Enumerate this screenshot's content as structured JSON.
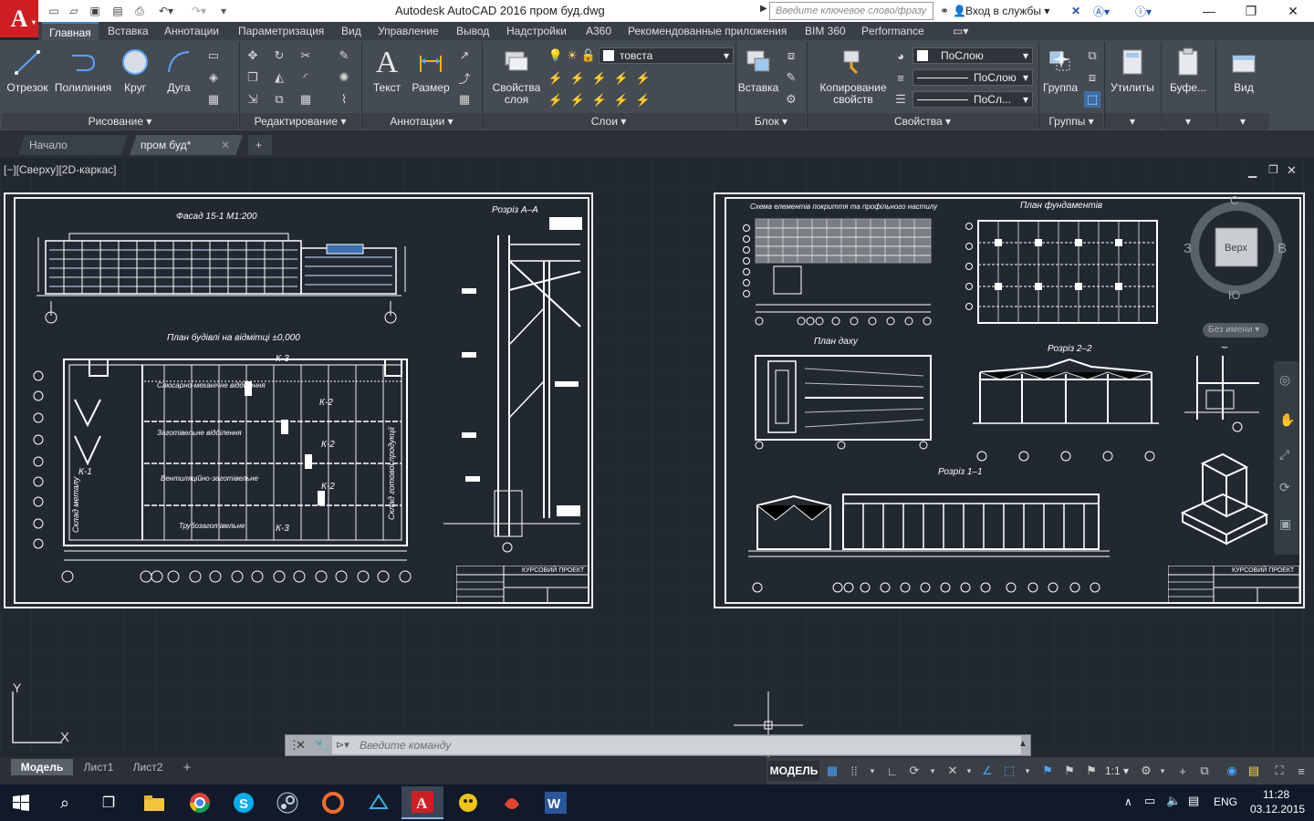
{
  "app": {
    "logo_letter": "A",
    "title": "Autodesk AutoCAD 2016    пром буд.dwg",
    "search_placeholder": "Введите ключевое слово/фразу",
    "login": "Вход в службы",
    "accent": "#3b88c8",
    "brand": "#cf1f25"
  },
  "ribbon_tabs": [
    "Главная",
    "Вставка",
    "Аннотации",
    "Параметризация",
    "Вид",
    "Управление",
    "Вывод",
    "Надстройки",
    "A360",
    "Рекомендованные приложения",
    "BIM 360",
    "Performance"
  ],
  "ribbon": {
    "draw": {
      "line": "Отрезок",
      "polyline": "Полилиния",
      "circle": "Круг",
      "arc": "Дуга",
      "panel": "Рисование"
    },
    "modify": {
      "panel": "Редактирование"
    },
    "annotation": {
      "text": "Текст",
      "dimension": "Размер",
      "panel": "Аннотации"
    },
    "layers": {
      "props": "Свойства слоя",
      "current_layer": "товста",
      "panel": "Слои"
    },
    "block": {
      "insert": "Вставка",
      "panel": "Блок"
    },
    "properties": {
      "copy": "Копирование свойств",
      "color": "ПоСлою",
      "linetype": "ПоСлою",
      "lineweight": "ПоСл...",
      "panel": "Свойства"
    },
    "groups": {
      "group": "Группа",
      "panel": "Группы"
    },
    "utilities": "Утилиты",
    "clipboard": "Буфе...",
    "view": "Вид"
  },
  "doc_tabs": {
    "start": "Начало",
    "current": "пром буд*"
  },
  "viewport": {
    "label": "[−][Сверху][2D-каркас]"
  },
  "viewcube": {
    "top": "Верх",
    "north": "С",
    "south": "Ю",
    "east": "В",
    "west": "З",
    "wcs": "Без имени"
  },
  "sheet_left": {
    "facade": "Фасад 15-1 М1:200",
    "plan": "План будівлі на відмітці ±0,000",
    "section": "Розріз А–А",
    "k3": "К-3",
    "k2": "К-2",
    "k1": "К-1",
    "room1": "Слюсарно-механічне відділення",
    "room2": "Заготівельне відділення",
    "room3": "Вентиляційно-заготівельне",
    "room4": "Трубозаготівельне",
    "store1": "Склад металу",
    "store2": "Склад готової продукції",
    "stamp": "КУРСОВИЙ ПРОЕКТ"
  },
  "sheet_right": {
    "scheme": "Схема елементів покриття та профільного настилу",
    "foundation": "План фундаментів",
    "roof": "План даху",
    "section22": "Розріз 2–2",
    "section11": "Розріз 1–1",
    "stamp": "КУРСОВИЙ ПРОЕКТ"
  },
  "axes": {
    "x": "X",
    "y": "Y"
  },
  "command": {
    "placeholder": "Введите команду"
  },
  "layout_tabs": [
    "Модель",
    "Лист1",
    "Лист2"
  ],
  "status": {
    "model": "МОДЕЛЬ",
    "scale": "1:1"
  },
  "taskbar": {
    "lang": "ENG",
    "time": "11:28",
    "date": "03.12.2015"
  }
}
